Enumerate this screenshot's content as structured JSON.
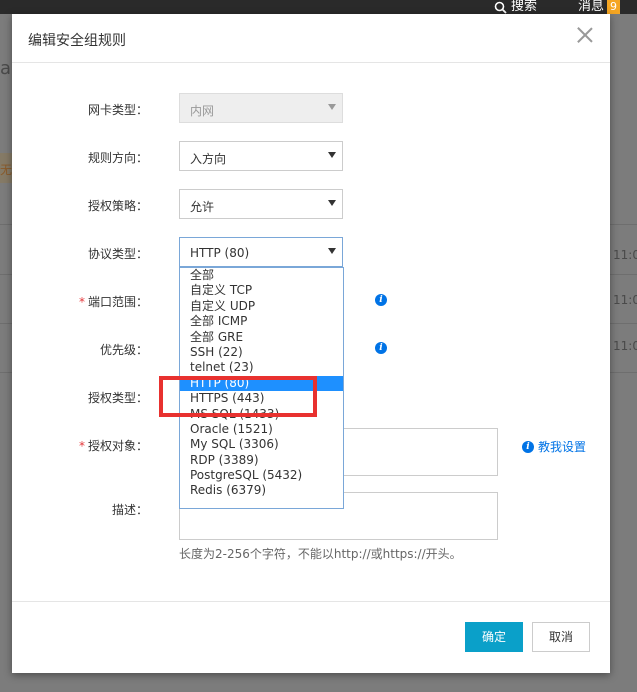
{
  "topbar": {
    "search_label": "搜索",
    "messages_label": "消息",
    "messages_count": "9"
  },
  "background": {
    "times": [
      "11:0",
      "11:0",
      "11:0"
    ],
    "fragment_a": "a.",
    "fragment_b": "无"
  },
  "modal": {
    "title": "编辑安全组规则",
    "fields": {
      "nic_type": {
        "label": "网卡类型：",
        "value": "内网"
      },
      "direction": {
        "label": "规则方向：",
        "value": "入方向"
      },
      "policy": {
        "label": "授权策略：",
        "value": "允许"
      },
      "protocol": {
        "label": "协议类型：",
        "value": "HTTP (80)"
      },
      "port_range": {
        "label": "端口范围："
      },
      "priority": {
        "label": "优先级："
      },
      "auth_type": {
        "label": "授权类型："
      },
      "auth_object": {
        "label": "授权对象：",
        "help_link": "教我设置"
      },
      "description": {
        "label": "描述：",
        "hint": "长度为2-256个字符，不能以http://或https://开头。"
      }
    },
    "protocol_options": [
      "全部",
      "自定义 TCP",
      "自定义 UDP",
      "全部 ICMP",
      "全部 GRE",
      "SSH (22)",
      "telnet (23)",
      "HTTP (80)",
      "HTTPS (443)",
      "MS SQL (1433)",
      "Oracle (1521)",
      "My SQL (3306)",
      "RDP (3389)",
      "PostgreSQL (5432)",
      "Redis (6379)"
    ],
    "selected_option": "HTTP (80)",
    "buttons": {
      "ok": "确定",
      "cancel": "取消"
    }
  },
  "colors": {
    "primary_button": "#0aa0c9",
    "selection": "#1e90ff",
    "link": "#0073e6",
    "highlight": "#e8312f"
  }
}
